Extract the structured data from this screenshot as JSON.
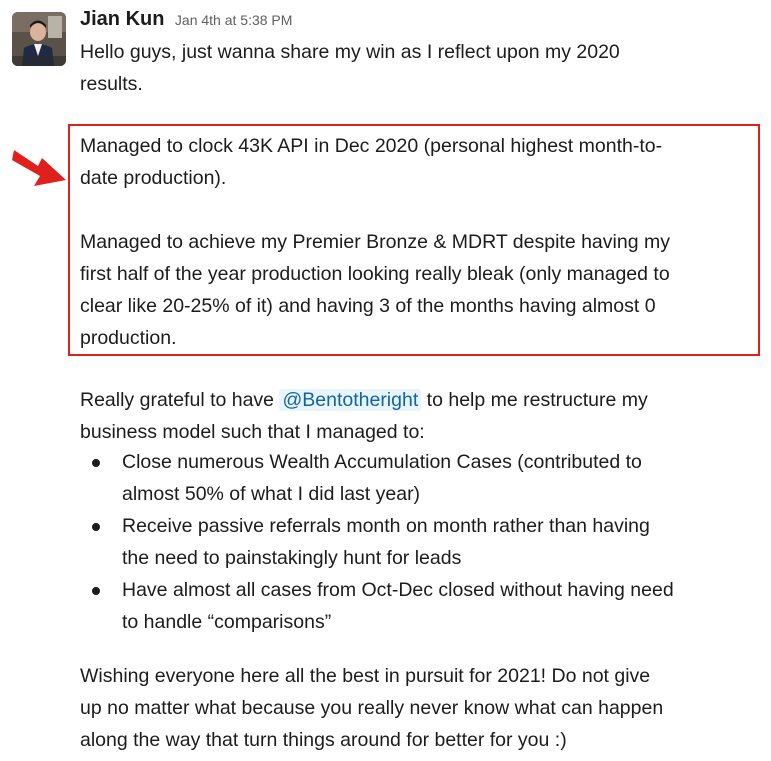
{
  "message": {
    "author": "Jian Kun",
    "timestamp": "Jan 4th at 5:38 PM",
    "intro": [
      "Hello guys, just wanna share my win as I reflect upon my 2020",
      "results."
    ],
    "highlight_p1": [
      "Managed to clock 43K API in Dec 2020 (personal highest month-to-",
      "date production)."
    ],
    "highlight_p2": [
      "Managed to achieve my Premier Bronze & MDRT despite having my",
      "first half of the year production looking really bleak (only managed to",
      "clear like 20-25% of it) and having 3 of the months having almost 0",
      "production."
    ],
    "grateful_prefix": "Really grateful to have ",
    "mention": "@Bentotheright",
    "grateful_suffix": " to help me restructure my",
    "grateful_line2": "business model such that I managed to:",
    "bullets": [
      [
        "Close numerous Wealth Accumulation Cases (contributed to",
        "almost 50% of what I did last year)"
      ],
      [
        "Receive passive referrals month on month rather than having",
        "the need to painstakingly hunt for leads"
      ],
      [
        "Have almost all cases from Oct-Dec closed without having need",
        "to handle “comparisons”"
      ]
    ],
    "closing": [
      "Wishing everyone here all the best in pursuit for 2021! Do not give",
      "up no matter what because you really never know what can happen",
      "along the way that turn things around for better for you :)"
    ]
  },
  "annotation": {
    "highlight_color": "#e0201c",
    "arrow_icon": "red-arrow-icon"
  },
  "colors": {
    "mention_bg": "#e8f5fa",
    "mention_text": "#1264a3",
    "text": "#1d1c1d",
    "timestamp": "#616061"
  }
}
